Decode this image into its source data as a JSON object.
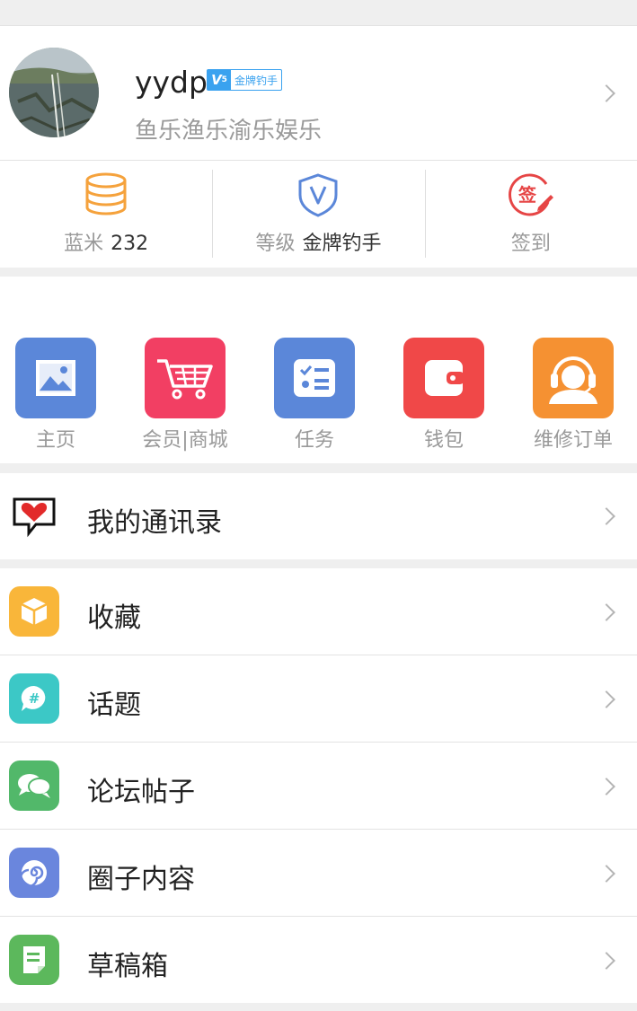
{
  "profile": {
    "username": "yydp",
    "badge_level": "V",
    "badge_sub": "5",
    "badge_title": "金牌钓手",
    "signature": "鱼乐渔乐渝乐娱乐"
  },
  "stats": [
    {
      "label": "蓝米",
      "value": "232",
      "icon": "coins-icon",
      "color": "#f5a23c"
    },
    {
      "label": "等级",
      "value": "金牌钓手",
      "icon": "shield-v-icon",
      "color": "#5b87d9"
    },
    {
      "label": "签到",
      "value": "",
      "icon": "sign-in-icon",
      "color": "#e64545",
      "icon_text": "签"
    }
  ],
  "grid": [
    {
      "label": "主页",
      "icon": "image-icon",
      "color": "#5b87d9"
    },
    {
      "label": "会员|商城",
      "icon": "shopping-cart-icon",
      "color": "#f23f63"
    },
    {
      "label": "任务",
      "icon": "task-list-icon",
      "color": "#5b87d9"
    },
    {
      "label": "钱包",
      "icon": "wallet-icon",
      "color": "#f04848"
    },
    {
      "label": "维修订单",
      "icon": "customer-service-icon",
      "color": "#f59132"
    }
  ],
  "menu": [
    {
      "label": "我的通讯录",
      "icon": "heart-bubble-icon",
      "color": "#e22a2a"
    },
    {
      "label": "收藏",
      "icon": "box-icon",
      "color": "#f9b63a"
    },
    {
      "label": "话题",
      "icon": "topic-hashtag-icon",
      "color": "#3cc8c6",
      "icon_text": "#"
    },
    {
      "label": "论坛帖子",
      "icon": "chat-bubbles-icon",
      "color": "#52b86a"
    },
    {
      "label": "圈子内容",
      "icon": "spiral-icon",
      "color": "#6a86dd"
    },
    {
      "label": "草稿箱",
      "icon": "draft-icon",
      "color": "#5cb85c"
    }
  ]
}
